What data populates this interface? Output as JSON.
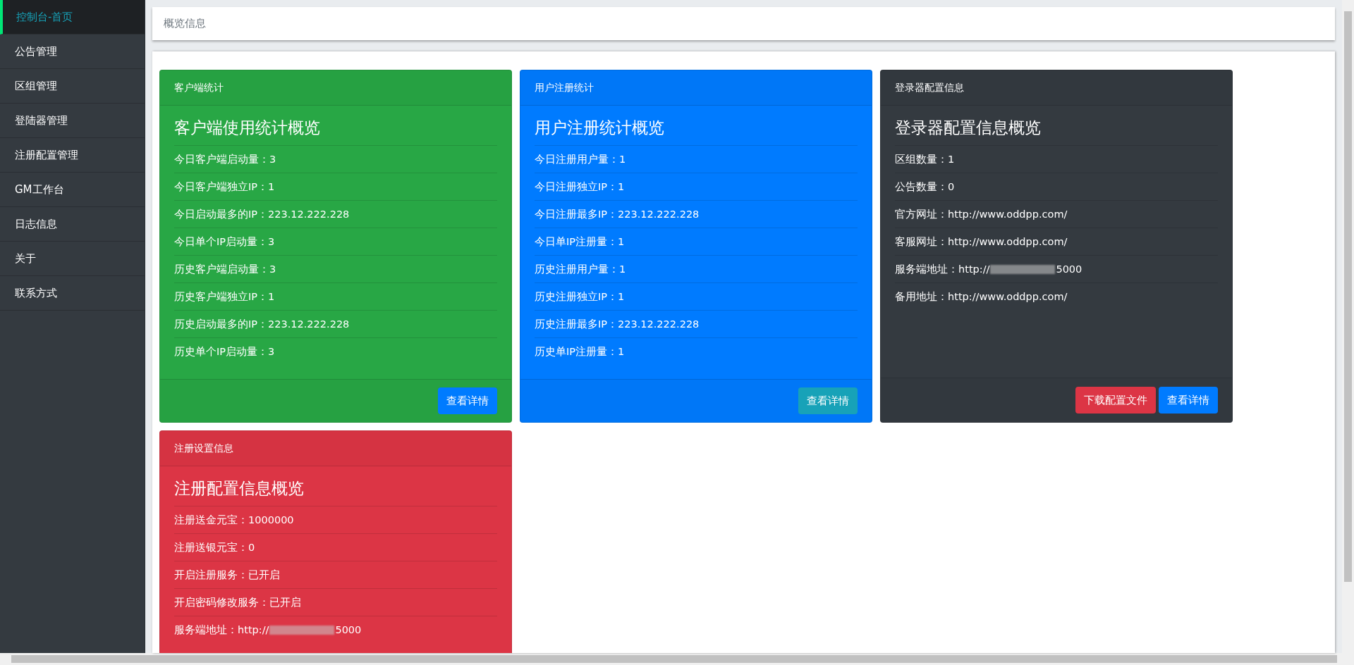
{
  "sidebar": {
    "items": [
      {
        "label": "控制台-首页",
        "selected": true
      },
      {
        "label": "公告管理",
        "selected": false
      },
      {
        "label": "区组管理",
        "selected": false
      },
      {
        "label": "登陆器管理",
        "selected": false
      },
      {
        "label": "注册配置管理",
        "selected": false
      },
      {
        "label": "GM工作台",
        "selected": false
      },
      {
        "label": "日志信息",
        "selected": false
      },
      {
        "label": "关于",
        "selected": false
      },
      {
        "label": "联系方式",
        "selected": false
      }
    ]
  },
  "header": {
    "title": "概览信息"
  },
  "cards": [
    {
      "header": "客户端统计",
      "color": "#28a745",
      "title": "客户端使用统计概览",
      "rows": [
        {
          "text": "今日客户端启动量：3"
        },
        {
          "text": "今日客户端独立IP：1"
        },
        {
          "text": "今日启动最多的IP：223.12.222.228"
        },
        {
          "text": "今日单个IP启动量：3"
        },
        {
          "text": "历史客户端启动量：3"
        },
        {
          "text": "历史客户端独立IP：1"
        },
        {
          "text": "历史启动最多的IP：223.12.222.228"
        },
        {
          "text": "历史单个IP启动量：3"
        }
      ],
      "buttons": [
        {
          "label": "查看详情",
          "kind": "primary"
        }
      ]
    },
    {
      "header": "用户注册统计",
      "color": "#007bff",
      "title": "用户注册统计概览",
      "rows": [
        {
          "text": "今日注册用户量：1"
        },
        {
          "text": "今日注册独立IP：1"
        },
        {
          "text": "今日注册最多IP：223.12.222.228"
        },
        {
          "text": "今日单IP注册量：1"
        },
        {
          "text": "历史注册用户量：1"
        },
        {
          "text": "历史注册独立IP：1"
        },
        {
          "text": "历史注册最多IP：223.12.222.228"
        },
        {
          "text": "历史单IP注册量：1"
        }
      ],
      "buttons": [
        {
          "label": "查看详情",
          "kind": "info"
        }
      ]
    },
    {
      "header": "登录器配置信息",
      "color": "#343a40",
      "title": "登录器配置信息概览",
      "rows": [
        {
          "text": "区组数量：1"
        },
        {
          "text": "公告数量：0"
        },
        {
          "text": "官方网址：http://www.oddpp.com/"
        },
        {
          "text": "客服网址：http://www.oddpp.com/"
        },
        {
          "text": "服务端地址：http://",
          "redacted": true,
          "suffix": "5000"
        },
        {
          "text": "备用地址：http://www.oddpp.com/"
        }
      ],
      "buttons": [
        {
          "label": "下载配置文件",
          "kind": "danger"
        },
        {
          "label": "查看详情",
          "kind": "primary"
        }
      ]
    },
    {
      "header": "注册设置信息",
      "color": "#dc3545",
      "title": "注册配置信息概览",
      "rows": [
        {
          "text": "注册送金元宝：1000000"
        },
        {
          "text": "注册送银元宝：0"
        },
        {
          "text": "开启注册服务：已开启"
        },
        {
          "text": "开启密码修改服务：已开启"
        },
        {
          "text": "服务端地址：http://",
          "redacted": true,
          "suffix": "5000"
        }
      ]
    }
  ]
}
